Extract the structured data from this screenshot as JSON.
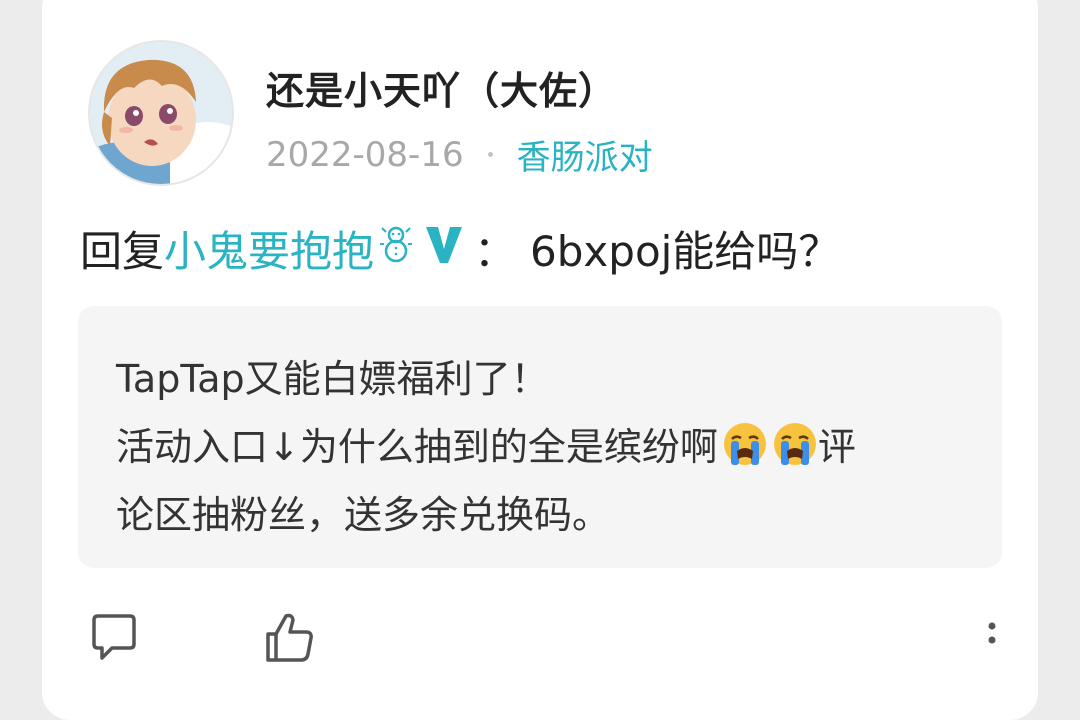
{
  "post": {
    "username": "还是小天吖（大佐）",
    "date": "2022-08-16",
    "game_tag": "香肠派对",
    "reply": {
      "prefix": "回复",
      "mention": "小鬼要抱抱",
      "colon": "：",
      "text": "6bxpoj能给吗？"
    },
    "quote": {
      "line1": "TapTap又能白嫖福利了！",
      "line2": "活动入口↓为什么抽到的全是缤纷啊",
      "line2_tail": " 评",
      "line3": "论区抽粉丝，送多余兑换码。"
    }
  },
  "icons": {
    "avatar": "anime-avatar",
    "snowman": "snowman-icon",
    "verified": "verified-v-icon",
    "emoji": "loudly-crying-face-icon",
    "comment": "comment-icon",
    "like": "thumbs-up-icon",
    "more": "more-vertical-icon"
  },
  "colors": {
    "accent": "#29b3c3",
    "text": "#222222",
    "muted": "#a8a8a8",
    "quote_bg": "#f5f5f5"
  }
}
